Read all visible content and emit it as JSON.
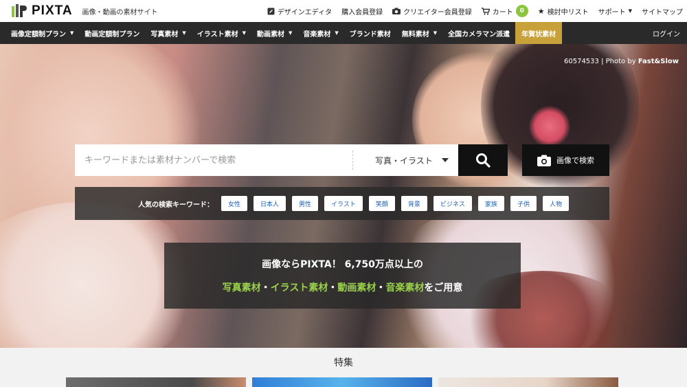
{
  "header": {
    "brand": "PIXTA",
    "tagline": "画像・動画の素材サイト",
    "links": [
      {
        "label": "デザインエディタ",
        "icon": "edit-icon"
      },
      {
        "label": "購入会員登録",
        "icon": ""
      },
      {
        "label": "クリエイター会員登録",
        "icon": "camera-icon"
      },
      {
        "label": "カート",
        "icon": "cart-icon",
        "badge": "0"
      },
      {
        "label": "検討中リスト",
        "icon": "star-icon"
      },
      {
        "label": "サポート",
        "icon": "",
        "dropdown": true
      },
      {
        "label": "サイトマップ",
        "icon": ""
      }
    ]
  },
  "nav": {
    "items": [
      {
        "label": "画像定額制プラン",
        "dropdown": true
      },
      {
        "label": "動画定額制プラン",
        "dropdown": false
      },
      {
        "label": "写真素材",
        "dropdown": true
      },
      {
        "label": "イラスト素材",
        "dropdown": true
      },
      {
        "label": "動画素材",
        "dropdown": true
      },
      {
        "label": "音楽素材",
        "dropdown": true
      },
      {
        "label": "ブランド素材",
        "dropdown": false
      },
      {
        "label": "無料素材",
        "dropdown": true
      },
      {
        "label": "全国カメラマン派遣",
        "dropdown": false
      },
      {
        "label": "年賀状素材",
        "dropdown": false,
        "highlight": true
      }
    ],
    "login": "ログイン"
  },
  "hero": {
    "photo_id": "60574533",
    "photo_by_prefix": "| Photo by",
    "photographer": "Fast&Slow",
    "search": {
      "placeholder": "キーワードまたは素材ナンバーで検索",
      "category": "写真・イラスト",
      "image_search_label": "画像で検索"
    },
    "keywords": {
      "label": "人気の検索キーワード：",
      "items": [
        "女性",
        "日本人",
        "男性",
        "イラスト",
        "笑顔",
        "背景",
        "ビジネス",
        "家族",
        "子供",
        "人物"
      ]
    },
    "promo": {
      "line1": "画像ならPIXTA！ 6,750万点以上の",
      "line2_parts": [
        {
          "text": "写真素材",
          "green": true
        },
        {
          "text": "・",
          "green": false
        },
        {
          "text": "イラスト素材",
          "green": true
        },
        {
          "text": "・",
          "green": false
        },
        {
          "text": "動画素材",
          "green": true
        },
        {
          "text": "・",
          "green": false
        },
        {
          "text": "音楽素材",
          "green": true
        },
        {
          "text": "をご用意",
          "green": false
        }
      ]
    }
  },
  "features": {
    "title": "特集"
  },
  "colors": {
    "accent_green": "#8cc63f",
    "promo_green": "#9bd24c",
    "nav_bg": "#2a2a2a",
    "nav_highlight": "#c8a13a",
    "link_blue": "#1a5fb4"
  }
}
